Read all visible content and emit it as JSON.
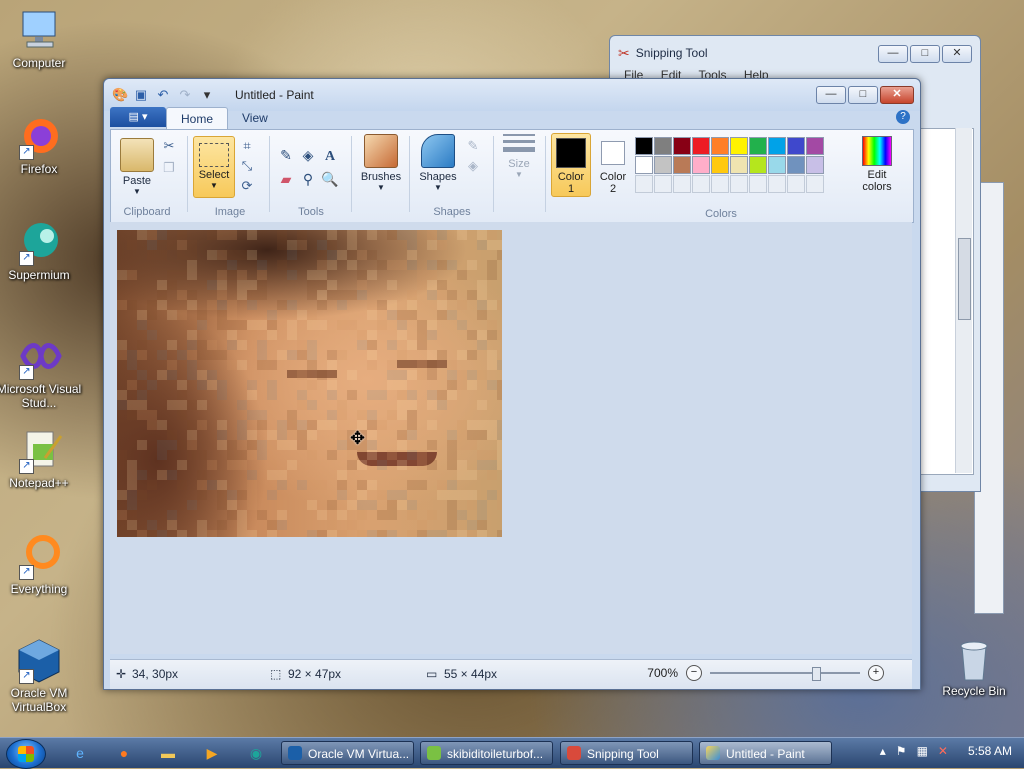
{
  "desktop": {
    "icons": [
      {
        "label": "Computer"
      },
      {
        "label": "Firefox"
      },
      {
        "label": "Supermium"
      },
      {
        "label": "Microsoft Visual Stud..."
      },
      {
        "label": "Notepad++"
      },
      {
        "label": "Everything"
      },
      {
        "label": "Oracle VM VirtualBox"
      }
    ],
    "recycle_bin": "Recycle Bin"
  },
  "snipping_tool": {
    "title": "Snipping Tool",
    "menu": [
      "File",
      "Edit",
      "Tools",
      "Help"
    ]
  },
  "paint": {
    "title": "Untitled - Paint",
    "tabs": {
      "menu": "▾",
      "home": "Home",
      "view": "View"
    },
    "clipboard": {
      "paste": "Paste",
      "group": "Clipboard"
    },
    "image": {
      "select": "Select",
      "group": "Image"
    },
    "tools": {
      "group": "Tools"
    },
    "brushes": {
      "label": "Brushes"
    },
    "shapes": {
      "label": "Shapes",
      "group": "Shapes"
    },
    "size": {
      "label": "Size"
    },
    "color1": {
      "label": "Color",
      "num": "1",
      "value": "#000000"
    },
    "color2": {
      "label": "Color",
      "num": "2",
      "value": "#ffffff"
    },
    "colors_group": "Colors",
    "edit_colors": {
      "line1": "Edit",
      "line2": "colors"
    },
    "palette_row1": [
      "#000000",
      "#7f7f7f",
      "#880015",
      "#ed1c24",
      "#ff7f27",
      "#fff200",
      "#22b14c",
      "#00a2e8",
      "#3f48cc",
      "#a349a4"
    ],
    "palette_row2": [
      "#ffffff",
      "#c3c3c3",
      "#b97a57",
      "#ffaec9",
      "#ffc90e",
      "#efe4b0",
      "#b5e61d",
      "#99d9ea",
      "#7092be",
      "#c8bfe7"
    ],
    "status": {
      "cursor": "34, 30px",
      "selection": "92 × 47px",
      "image_size": "55 × 44px",
      "zoom": "700%"
    }
  },
  "taskbar": {
    "tasks": [
      {
        "label": "Oracle VM Virtua..."
      },
      {
        "label": "skibiditoileturbof..."
      },
      {
        "label": "Snipping Tool"
      },
      {
        "label": "Untitled - Paint"
      }
    ],
    "time": "5:58 AM"
  }
}
